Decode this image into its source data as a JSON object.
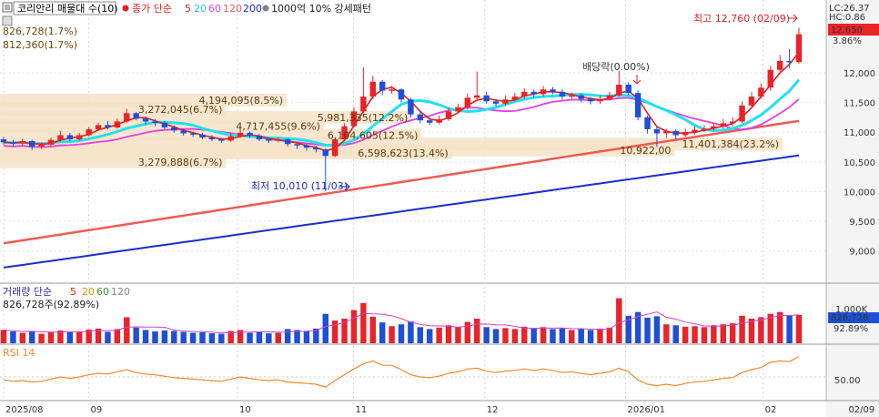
{
  "header": {
    "symbol": "코리안리 매물대 수(10)",
    "price_legend_prefix": "종가 단순",
    "ma_periods": [
      "5",
      "20",
      "60",
      "120",
      "200"
    ],
    "pattern_label": "1000억 10% 강세패턴",
    "lc_label": "LC:26.37",
    "hc_label": "HC:0.86"
  },
  "current": {
    "price_label": "12,650",
    "change_label": "3.86%"
  },
  "volume_header": {
    "title": "거래량 단순",
    "ma_periods": [
      "5",
      "20",
      "60",
      "120"
    ],
    "latest_label": "826,728주(92.89%)",
    "axis_current": "826,728",
    "axis_pct": "92.89%",
    "axis_tick": "1,000K"
  },
  "rsi_header": {
    "title": "RSI 14",
    "axis_tick": "50.00"
  },
  "annotations": {
    "high": "최고 12,760 (02/09)",
    "low": "최저 10,010 (11/03)",
    "dividend": "배당락(0.00%)",
    "corner_1": "826,728(1.7%)",
    "corner_2": "812,360(1.7%)"
  },
  "colors": {
    "up": "#e8242a",
    "down": "#1f4fd6",
    "ma5": "#e02020",
    "ma20": "#22e0f0",
    "ma60": "#e040e0",
    "ma120": "#f05a50",
    "ma200": "#1a2fcc",
    "profile": "#f6e3c8",
    "rsi": "#f08a30"
  },
  "chart_data": {
    "type": "candlestick",
    "title": "코리안리 매물대 수(10)",
    "x_ticks": [
      "2025/08",
      "09",
      "10",
      "11",
      "12",
      "2026/01",
      "02",
      "02/09"
    ],
    "price_axis": {
      "ticks": [
        "12,000",
        "11,500",
        "11,000",
        "10,500",
        "10,000",
        "9,500",
        "9,000"
      ],
      "ylim": [
        8550,
        12950
      ]
    },
    "volume_profile": [
      {
        "label": "4,194,095(8.5%)",
        "price": 11540
      },
      {
        "label": "3,272,045(6.7%)",
        "price": 11390
      },
      {
        "label": "5,981,335(12.2%)",
        "price": 11250
      },
      {
        "label": "4,717,455(9.6%)",
        "price": 11100
      },
      {
        "label": "6,104,605(12.5%)",
        "price": 10950
      },
      {
        "label": "11,401,384(23.2%)",
        "price": 10800
      },
      {
        "label": "10,922,00",
        "price": 10700
      },
      {
        "label": "6,598,623(13.4%)",
        "price": 10650
      },
      {
        "label": "3,279,888(6.7%)",
        "price": 10500
      }
    ],
    "ma200": {
      "start": 8720,
      "end": 10610
    },
    "ma120": {
      "start": 9130,
      "end": 11190
    },
    "candles": [
      [
        10880,
        10830,
        10920,
        10790
      ],
      [
        10830,
        10810,
        10870,
        10760
      ],
      [
        10810,
        10850,
        10890,
        10780
      ],
      [
        10850,
        10760,
        10870,
        10700
      ],
      [
        10760,
        10790,
        10830,
        10720
      ],
      [
        10790,
        10870,
        10910,
        10760
      ],
      [
        10870,
        10950,
        11020,
        10840
      ],
      [
        10950,
        10880,
        10990,
        10850
      ],
      [
        10880,
        10950,
        10990,
        10860
      ],
      [
        10950,
        11050,
        11090,
        10930
      ],
      [
        11050,
        11120,
        11160,
        11020
      ],
      [
        11120,
        11080,
        11190,
        11050
      ],
      [
        11080,
        11180,
        11230,
        11060
      ],
      [
        11180,
        11320,
        11390,
        11160
      ],
      [
        11320,
        11230,
        11340,
        11200
      ],
      [
        11230,
        11180,
        11260,
        11120
      ],
      [
        11180,
        11160,
        11220,
        11100
      ],
      [
        11160,
        11080,
        11190,
        11050
      ],
      [
        11080,
        11030,
        11110,
        10990
      ],
      [
        11030,
        10980,
        11060,
        10940
      ],
      [
        10980,
        10960,
        11010,
        10920
      ],
      [
        10960,
        10910,
        10990,
        10880
      ],
      [
        10910,
        10880,
        10950,
        10850
      ],
      [
        10880,
        10860,
        10910,
        10820
      ],
      [
        10860,
        10930,
        10980,
        10840
      ],
      [
        10930,
        10990,
        11040,
        10910
      ],
      [
        10990,
        10940,
        11020,
        10900
      ],
      [
        10940,
        10880,
        10970,
        10850
      ],
      [
        10880,
        10860,
        10910,
        10820
      ],
      [
        10860,
        10880,
        10920,
        10830
      ],
      [
        10880,
        10800,
        10900,
        10760
      ],
      [
        10800,
        10780,
        10830,
        10720
      ],
      [
        10780,
        10740,
        10800,
        10690
      ],
      [
        10740,
        10710,
        10770,
        10660
      ],
      [
        10710,
        10600,
        10730,
        10010
      ],
      [
        10600,
        10880,
        10910,
        10580
      ],
      [
        10880,
        11100,
        11150,
        10860
      ],
      [
        11100,
        11350,
        11420,
        11080
      ],
      [
        11350,
        11600,
        12090,
        11320
      ],
      [
        11600,
        11850,
        11950,
        11560
      ],
      [
        11850,
        11700,
        11880,
        11620
      ],
      [
        11700,
        11720,
        11780,
        11650
      ],
      [
        11720,
        11550,
        11740,
        11500
      ],
      [
        11550,
        11300,
        11580,
        11250
      ],
      [
        11300,
        11200,
        11360,
        11150
      ],
      [
        11200,
        11160,
        11250,
        11120
      ],
      [
        11160,
        11220,
        11280,
        11130
      ],
      [
        11220,
        11350,
        11420,
        11190
      ],
      [
        11350,
        11420,
        11480,
        11320
      ],
      [
        11420,
        11580,
        11650,
        11380
      ],
      [
        11580,
        11620,
        12020,
        11550
      ],
      [
        11620,
        11520,
        11680,
        11480
      ],
      [
        11520,
        11480,
        11560,
        11430
      ],
      [
        11480,
        11550,
        11620,
        11440
      ],
      [
        11550,
        11600,
        11660,
        11520
      ],
      [
        11600,
        11680,
        11740,
        11560
      ],
      [
        11680,
        11640,
        11720,
        11590
      ],
      [
        11640,
        11720,
        11780,
        11600
      ],
      [
        11720,
        11680,
        11760,
        11640
      ],
      [
        11680,
        11600,
        11720,
        11550
      ],
      [
        11600,
        11620,
        11670,
        11560
      ],
      [
        11620,
        11560,
        11650,
        11500
      ],
      [
        11560,
        11520,
        11590,
        11470
      ],
      [
        11520,
        11560,
        11620,
        11480
      ],
      [
        11560,
        11620,
        11680,
        11530
      ],
      [
        11620,
        11800,
        12030,
        11600
      ],
      [
        11800,
        11660,
        11840,
        11620
      ],
      [
        11660,
        11250,
        11700,
        11200
      ],
      [
        11250,
        11050,
        11280,
        10980
      ],
      [
        11050,
        10980,
        11100,
        10750
      ],
      [
        10980,
        11020,
        11060,
        10900
      ],
      [
        11020,
        10950,
        11050,
        10880
      ],
      [
        10950,
        11000,
        11060,
        10920
      ],
      [
        11000,
        11040,
        11100,
        10960
      ],
      [
        11040,
        11060,
        11120,
        11000
      ],
      [
        11060,
        11100,
        11160,
        11030
      ],
      [
        11100,
        11150,
        11220,
        11060
      ],
      [
        11150,
        11180,
        11250,
        11100
      ],
      [
        11180,
        11450,
        11520,
        11150
      ],
      [
        11450,
        11600,
        11680,
        11420
      ],
      [
        11600,
        11750,
        11820,
        11560
      ],
      [
        11750,
        12050,
        12120,
        11700
      ],
      [
        12050,
        12200,
        12300,
        11980
      ],
      [
        12200,
        12180,
        12400,
        12080
      ],
      [
        12180,
        12650,
        12760,
        12150
      ]
    ],
    "volume": [
      [
        0.28,
        1
      ],
      [
        0.25,
        0
      ],
      [
        0.22,
        1
      ],
      [
        0.26,
        0
      ],
      [
        0.2,
        1
      ],
      [
        0.24,
        1
      ],
      [
        0.27,
        1
      ],
      [
        0.23,
        0
      ],
      [
        0.25,
        1
      ],
      [
        0.29,
        1
      ],
      [
        0.31,
        1
      ],
      [
        0.24,
        0
      ],
      [
        0.3,
        1
      ],
      [
        0.55,
        1
      ],
      [
        0.33,
        0
      ],
      [
        0.28,
        0
      ],
      [
        0.25,
        0
      ],
      [
        0.27,
        0
      ],
      [
        0.26,
        0
      ],
      [
        0.24,
        0
      ],
      [
        0.22,
        0
      ],
      [
        0.23,
        0
      ],
      [
        0.21,
        0
      ],
      [
        0.2,
        0
      ],
      [
        0.26,
        1
      ],
      [
        0.28,
        1
      ],
      [
        0.22,
        0
      ],
      [
        0.24,
        0
      ],
      [
        0.21,
        0
      ],
      [
        0.22,
        1
      ],
      [
        0.3,
        0
      ],
      [
        0.28,
        0
      ],
      [
        0.26,
        0
      ],
      [
        0.31,
        0
      ],
      [
        0.62,
        0
      ],
      [
        0.48,
        1
      ],
      [
        0.52,
        1
      ],
      [
        0.7,
        1
      ],
      [
        0.85,
        1
      ],
      [
        0.56,
        1
      ],
      [
        0.44,
        0
      ],
      [
        0.36,
        1
      ],
      [
        0.4,
        0
      ],
      [
        0.46,
        0
      ],
      [
        0.34,
        0
      ],
      [
        0.3,
        0
      ],
      [
        0.33,
        1
      ],
      [
        0.38,
        1
      ],
      [
        0.34,
        1
      ],
      [
        0.45,
        1
      ],
      [
        0.52,
        1
      ],
      [
        0.34,
        0
      ],
      [
        0.3,
        0
      ],
      [
        0.32,
        1
      ],
      [
        0.3,
        1
      ],
      [
        0.35,
        1
      ],
      [
        0.31,
        0
      ],
      [
        0.34,
        1
      ],
      [
        0.3,
        0
      ],
      [
        0.32,
        0
      ],
      [
        0.28,
        1
      ],
      [
        0.3,
        0
      ],
      [
        0.28,
        0
      ],
      [
        0.31,
        1
      ],
      [
        0.33,
        1
      ],
      [
        0.95,
        1
      ],
      [
        0.58,
        0
      ],
      [
        0.66,
        0
      ],
      [
        0.54,
        0
      ],
      [
        0.57,
        0
      ],
      [
        0.4,
        1
      ],
      [
        0.38,
        0
      ],
      [
        0.35,
        1
      ],
      [
        0.36,
        1
      ],
      [
        0.34,
        1
      ],
      [
        0.38,
        1
      ],
      [
        0.4,
        1
      ],
      [
        0.42,
        1
      ],
      [
        0.58,
        1
      ],
      [
        0.52,
        1
      ],
      [
        0.55,
        1
      ],
      [
        0.62,
        1
      ],
      [
        0.66,
        1
      ],
      [
        0.58,
        0
      ],
      [
        0.6,
        1
      ]
    ],
    "rsi_levels": [
      46,
      44,
      45,
      43,
      44,
      47,
      50,
      48,
      50,
      53,
      55,
      54,
      57,
      60,
      56,
      54,
      53,
      51,
      49,
      48,
      47,
      46,
      45,
      44,
      47,
      50,
      48,
      46,
      45,
      46,
      43,
      42,
      41,
      40,
      36,
      45,
      53,
      61,
      68,
      72,
      66,
      66,
      60,
      53,
      50,
      49,
      51,
      55,
      57,
      61,
      62,
      58,
      56,
      58,
      59,
      61,
      59,
      61,
      59,
      56,
      57,
      55,
      53,
      55,
      57,
      62,
      57,
      46,
      40,
      38,
      40,
      38,
      41,
      43,
      44,
      46,
      48,
      49,
      56,
      60,
      63,
      70,
      72,
      71,
      78
    ]
  }
}
